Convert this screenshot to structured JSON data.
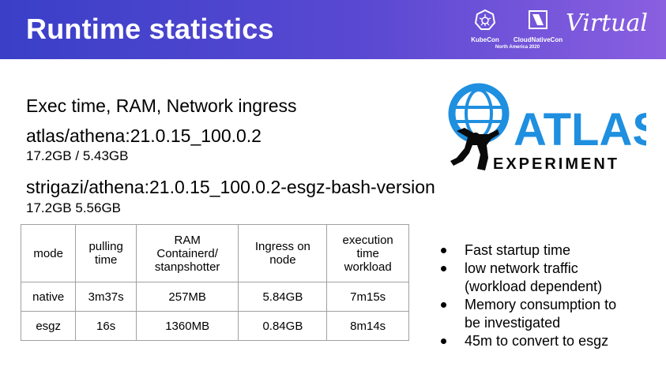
{
  "header": {
    "title": "Runtime statistics",
    "kubecon": "KubeCon",
    "cncf": "CloudNativeCon",
    "region": "North America 2020",
    "virtual": "Virtual",
    "header_color": "#4a44cc"
  },
  "content": {
    "subtitle": "Exec time, RAM, Network ingress",
    "image1": "atlas/athena:21.0.15_100.0.2",
    "image1_size": "17.2GB / 5.43GB",
    "image2": "strigazi/athena:21.0.15_100.0.2-esgz-bash-version",
    "image2_size": "17.2GB  5.56GB"
  },
  "atlas_logo": {
    "word": "ATLAS",
    "subword": "EXPERIMENT",
    "color_blue": "#1f8fe0",
    "color_dark": "#0a0a0a"
  },
  "table": {
    "headers": [
      [
        "mode"
      ],
      [
        "pulling",
        "time"
      ],
      [
        "RAM",
        "Containerd/",
        "stanpshotter"
      ],
      [
        "Ingress on",
        "node"
      ],
      [
        "execution",
        "time",
        "workload"
      ]
    ],
    "rows": [
      [
        "native",
        "3m37s",
        "257MB",
        "5.84GB",
        "7m15s"
      ],
      [
        "esgz",
        "16s",
        "1360MB",
        "0.84GB",
        "8m14s"
      ]
    ]
  },
  "bullets": [
    [
      "Fast startup time"
    ],
    [
      "low network traffic",
      "(workload dependent)"
    ],
    [
      "Memory consumption to",
      "be investigated"
    ],
    [
      "45m to convert to esgz"
    ]
  ]
}
